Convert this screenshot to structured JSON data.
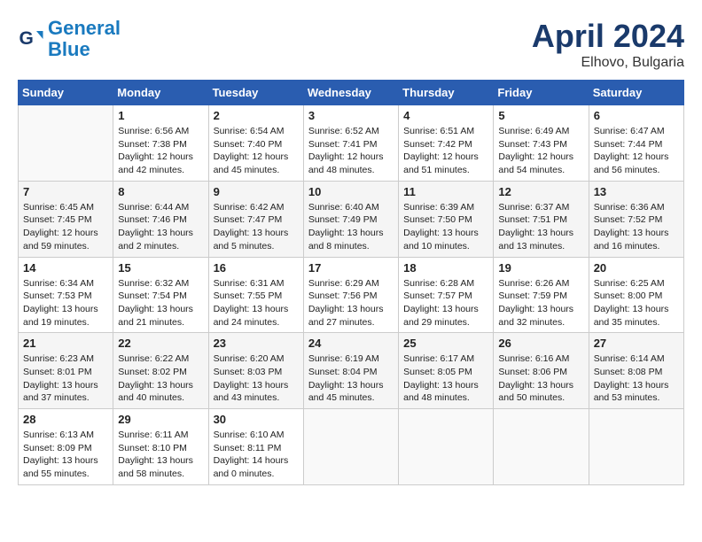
{
  "header": {
    "logo_line1": "General",
    "logo_line2": "Blue",
    "month": "April 2024",
    "location": "Elhovo, Bulgaria"
  },
  "weekdays": [
    "Sunday",
    "Monday",
    "Tuesday",
    "Wednesday",
    "Thursday",
    "Friday",
    "Saturday"
  ],
  "weeks": [
    [
      {
        "day": "",
        "info": ""
      },
      {
        "day": "1",
        "info": "Sunrise: 6:56 AM\nSunset: 7:38 PM\nDaylight: 12 hours\nand 42 minutes."
      },
      {
        "day": "2",
        "info": "Sunrise: 6:54 AM\nSunset: 7:40 PM\nDaylight: 12 hours\nand 45 minutes."
      },
      {
        "day": "3",
        "info": "Sunrise: 6:52 AM\nSunset: 7:41 PM\nDaylight: 12 hours\nand 48 minutes."
      },
      {
        "day": "4",
        "info": "Sunrise: 6:51 AM\nSunset: 7:42 PM\nDaylight: 12 hours\nand 51 minutes."
      },
      {
        "day": "5",
        "info": "Sunrise: 6:49 AM\nSunset: 7:43 PM\nDaylight: 12 hours\nand 54 minutes."
      },
      {
        "day": "6",
        "info": "Sunrise: 6:47 AM\nSunset: 7:44 PM\nDaylight: 12 hours\nand 56 minutes."
      }
    ],
    [
      {
        "day": "7",
        "info": "Sunrise: 6:45 AM\nSunset: 7:45 PM\nDaylight: 12 hours\nand 59 minutes."
      },
      {
        "day": "8",
        "info": "Sunrise: 6:44 AM\nSunset: 7:46 PM\nDaylight: 13 hours\nand 2 minutes."
      },
      {
        "day": "9",
        "info": "Sunrise: 6:42 AM\nSunset: 7:47 PM\nDaylight: 13 hours\nand 5 minutes."
      },
      {
        "day": "10",
        "info": "Sunrise: 6:40 AM\nSunset: 7:49 PM\nDaylight: 13 hours\nand 8 minutes."
      },
      {
        "day": "11",
        "info": "Sunrise: 6:39 AM\nSunset: 7:50 PM\nDaylight: 13 hours\nand 10 minutes."
      },
      {
        "day": "12",
        "info": "Sunrise: 6:37 AM\nSunset: 7:51 PM\nDaylight: 13 hours\nand 13 minutes."
      },
      {
        "day": "13",
        "info": "Sunrise: 6:36 AM\nSunset: 7:52 PM\nDaylight: 13 hours\nand 16 minutes."
      }
    ],
    [
      {
        "day": "14",
        "info": "Sunrise: 6:34 AM\nSunset: 7:53 PM\nDaylight: 13 hours\nand 19 minutes."
      },
      {
        "day": "15",
        "info": "Sunrise: 6:32 AM\nSunset: 7:54 PM\nDaylight: 13 hours\nand 21 minutes."
      },
      {
        "day": "16",
        "info": "Sunrise: 6:31 AM\nSunset: 7:55 PM\nDaylight: 13 hours\nand 24 minutes."
      },
      {
        "day": "17",
        "info": "Sunrise: 6:29 AM\nSunset: 7:56 PM\nDaylight: 13 hours\nand 27 minutes."
      },
      {
        "day": "18",
        "info": "Sunrise: 6:28 AM\nSunset: 7:57 PM\nDaylight: 13 hours\nand 29 minutes."
      },
      {
        "day": "19",
        "info": "Sunrise: 6:26 AM\nSunset: 7:59 PM\nDaylight: 13 hours\nand 32 minutes."
      },
      {
        "day": "20",
        "info": "Sunrise: 6:25 AM\nSunset: 8:00 PM\nDaylight: 13 hours\nand 35 minutes."
      }
    ],
    [
      {
        "day": "21",
        "info": "Sunrise: 6:23 AM\nSunset: 8:01 PM\nDaylight: 13 hours\nand 37 minutes."
      },
      {
        "day": "22",
        "info": "Sunrise: 6:22 AM\nSunset: 8:02 PM\nDaylight: 13 hours\nand 40 minutes."
      },
      {
        "day": "23",
        "info": "Sunrise: 6:20 AM\nSunset: 8:03 PM\nDaylight: 13 hours\nand 43 minutes."
      },
      {
        "day": "24",
        "info": "Sunrise: 6:19 AM\nSunset: 8:04 PM\nDaylight: 13 hours\nand 45 minutes."
      },
      {
        "day": "25",
        "info": "Sunrise: 6:17 AM\nSunset: 8:05 PM\nDaylight: 13 hours\nand 48 minutes."
      },
      {
        "day": "26",
        "info": "Sunrise: 6:16 AM\nSunset: 8:06 PM\nDaylight: 13 hours\nand 50 minutes."
      },
      {
        "day": "27",
        "info": "Sunrise: 6:14 AM\nSunset: 8:08 PM\nDaylight: 13 hours\nand 53 minutes."
      }
    ],
    [
      {
        "day": "28",
        "info": "Sunrise: 6:13 AM\nSunset: 8:09 PM\nDaylight: 13 hours\nand 55 minutes."
      },
      {
        "day": "29",
        "info": "Sunrise: 6:11 AM\nSunset: 8:10 PM\nDaylight: 13 hours\nand 58 minutes."
      },
      {
        "day": "30",
        "info": "Sunrise: 6:10 AM\nSunset: 8:11 PM\nDaylight: 14 hours\nand 0 minutes."
      },
      {
        "day": "",
        "info": ""
      },
      {
        "day": "",
        "info": ""
      },
      {
        "day": "",
        "info": ""
      },
      {
        "day": "",
        "info": ""
      }
    ]
  ]
}
